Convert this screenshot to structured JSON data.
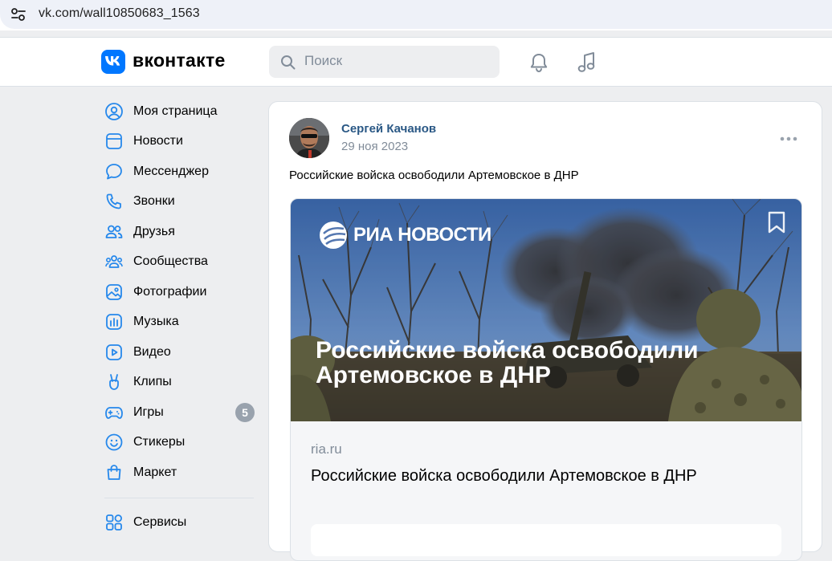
{
  "browser": {
    "url": "vk.com/wall10850683_1563"
  },
  "header": {
    "logo_text": "вконтакте",
    "search_placeholder": "Поиск"
  },
  "sidebar": {
    "items": [
      {
        "label": "Моя страница",
        "icon": "user-circle-icon"
      },
      {
        "label": "Новости",
        "icon": "news-icon"
      },
      {
        "label": "Мессенджер",
        "icon": "message-icon"
      },
      {
        "label": "Звонки",
        "icon": "phone-icon"
      },
      {
        "label": "Друзья",
        "icon": "friends-icon"
      },
      {
        "label": "Сообщества",
        "icon": "communities-icon"
      },
      {
        "label": "Фотографии",
        "icon": "photo-icon"
      },
      {
        "label": "Музыка",
        "icon": "music-icon"
      },
      {
        "label": "Видео",
        "icon": "video-icon"
      },
      {
        "label": "Клипы",
        "icon": "clips-icon"
      },
      {
        "label": "Игры",
        "icon": "gamepad-icon",
        "badge": "5"
      },
      {
        "label": "Стикеры",
        "icon": "smile-icon"
      },
      {
        "label": "Маркет",
        "icon": "bag-icon"
      }
    ],
    "services_label": "Сервисы"
  },
  "post": {
    "author": "Сергей Качанов",
    "date": "29 ноя 2023",
    "text": "Российские войска освободили Артемовское в ДНР",
    "attachment": {
      "brand": "РИА НОВОСТИ",
      "headline": "Российские войска освободили Артемовское в ДНР",
      "domain": "ria.ru",
      "title": "Российские войска освободили Артемовское в ДНР"
    }
  },
  "colors": {
    "accent": "#0077ff",
    "author_link": "#2a5885",
    "muted": "#818c99",
    "page_bg": "#edeef0",
    "icon_blue": "#2688eb"
  }
}
